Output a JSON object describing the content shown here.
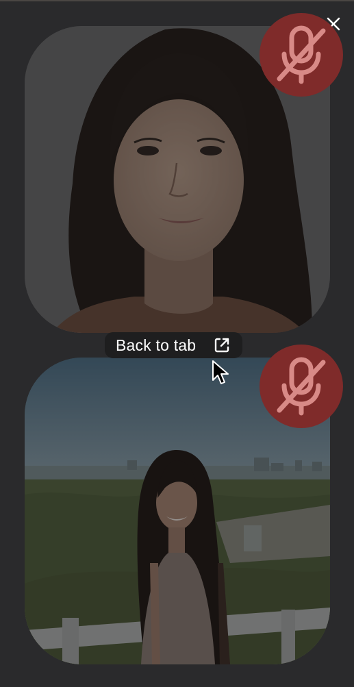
{
  "window": {
    "close_icon": "close-icon"
  },
  "participants": [
    {
      "id": "participant-1",
      "muted": true,
      "mic_icon": "microphone-muted-icon",
      "badge_color": "#7f2b2a"
    },
    {
      "id": "participant-2",
      "muted": true,
      "mic_icon": "microphone-muted-icon",
      "badge_color": "#7f2b2a"
    }
  ],
  "back_to_tab": {
    "label": "Back to tab",
    "icon": "open-external-icon"
  },
  "colors": {
    "background": "#2a2a2c",
    "pill": "#1e1e1f",
    "mute_badge": "#7f2b2a",
    "text": "#ffffff"
  }
}
